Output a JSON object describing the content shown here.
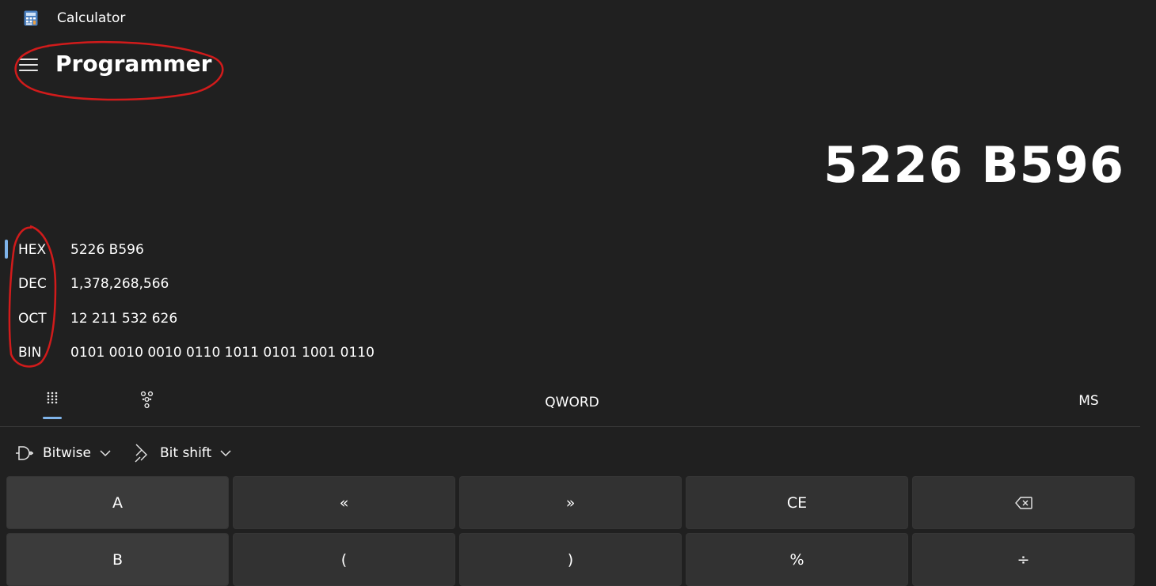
{
  "window": {
    "title": "Calculator",
    "icon": "calculator-app-icon"
  },
  "header": {
    "menu_icon": "hamburger-icon",
    "mode": "Programmer"
  },
  "display": {
    "value": "5226 B596"
  },
  "radix": {
    "selected": "HEX",
    "rows": [
      {
        "label": "HEX",
        "value": "5226 B596"
      },
      {
        "label": "DEC",
        "value": "1,378,268,566"
      },
      {
        "label": "OCT",
        "value": "12 211 532 626"
      },
      {
        "label": "BIN",
        "value": "0101 0010 0010 0110 1011 0101 1001 0110"
      }
    ]
  },
  "toolbar": {
    "keypad_icon": "full-keypad-icon",
    "bit_toggle_icon": "bit-toggling-keypad-icon",
    "word_size": "QWORD",
    "memory_store": "MS"
  },
  "operators": {
    "bitwise": {
      "label": "Bitwise",
      "icon": "logic-gate-icon"
    },
    "bitshift": {
      "label": "Bit shift",
      "icon": "bit-shift-icon"
    }
  },
  "keypad": {
    "row1": [
      "A",
      "«",
      "»",
      "CE",
      "backspace-icon"
    ],
    "row2": [
      "B",
      "(",
      ")",
      "%",
      "÷"
    ]
  },
  "annotation_color": "#d11b1b",
  "accent_color": "#7fb4ea"
}
